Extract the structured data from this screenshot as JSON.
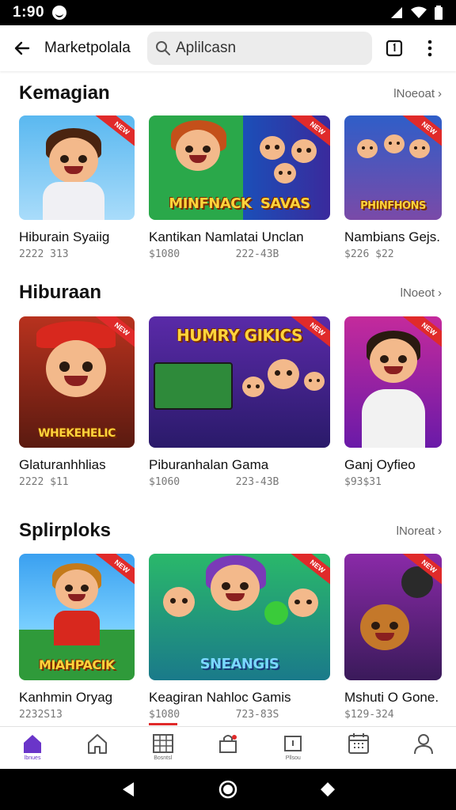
{
  "status": {
    "time": "1:90"
  },
  "appbar": {
    "title": "Marketpolala",
    "search_text": "Aplilcasn"
  },
  "sections": [
    {
      "heading": "Kemagian",
      "more": "lNoeoat",
      "items": [
        {
          "name": "Hiburain Syaiig",
          "sub": "2222 313",
          "art": "",
          "ribbon": "NEW"
        },
        {
          "name": "Kantikan Namlatai Unclan",
          "sub": "$1080         222-43B",
          "art": "MINFNACK  SAVAS",
          "ribbon": "NEW"
        },
        {
          "name": "Nambians Gejs.",
          "sub": "$226 $22",
          "art": "PHINFHONS",
          "ribbon": "NEW"
        }
      ]
    },
    {
      "heading": "Hiburaan",
      "more": "lNoeot",
      "items": [
        {
          "name": "Glaturanhhlias",
          "sub": "2222 $11",
          "art": "WHEKEHELIC",
          "ribbon": "NEW"
        },
        {
          "name": "Piburanhalan Gama",
          "sub": "$1060         223-43B",
          "art": "HUMRY GIKICS",
          "ribbon": "NEW"
        },
        {
          "name": "Ganj Oyfieo",
          "sub": "$93$31",
          "art": "",
          "ribbon": "NEW"
        }
      ]
    },
    {
      "heading": "Splirploks",
      "more": "lNoreat",
      "items": [
        {
          "name": "Kanhmin Oryag",
          "sub": "2232S13",
          "art": "MIAHPACIK",
          "ribbon": "NEW"
        },
        {
          "name": "Keagiran Nahloc Gamis",
          "sub": "$1080         723-83S",
          "art": "SNEANGIS",
          "ribbon": "NEW"
        },
        {
          "name": "Mshuti O Gone.",
          "sub": "$129-324",
          "art": "",
          "ribbon": "NEW"
        }
      ]
    }
  ],
  "bottomnav": [
    {
      "icon": "home-filled-icon",
      "label": "lbnues"
    },
    {
      "icon": "home-outline-icon",
      "label": ""
    },
    {
      "icon": "grid-icon",
      "label": "Bosntsl"
    },
    {
      "icon": "bag-icon",
      "label": ""
    },
    {
      "icon": "calendar-mini-icon",
      "label": "Pllsou"
    },
    {
      "icon": "calendar-icon",
      "label": ""
    },
    {
      "icon": "person-icon",
      "label": ""
    }
  ],
  "colors": {
    "accent": "#6a35c9",
    "ribbon": "#e02a2a",
    "muted": "#777777"
  }
}
